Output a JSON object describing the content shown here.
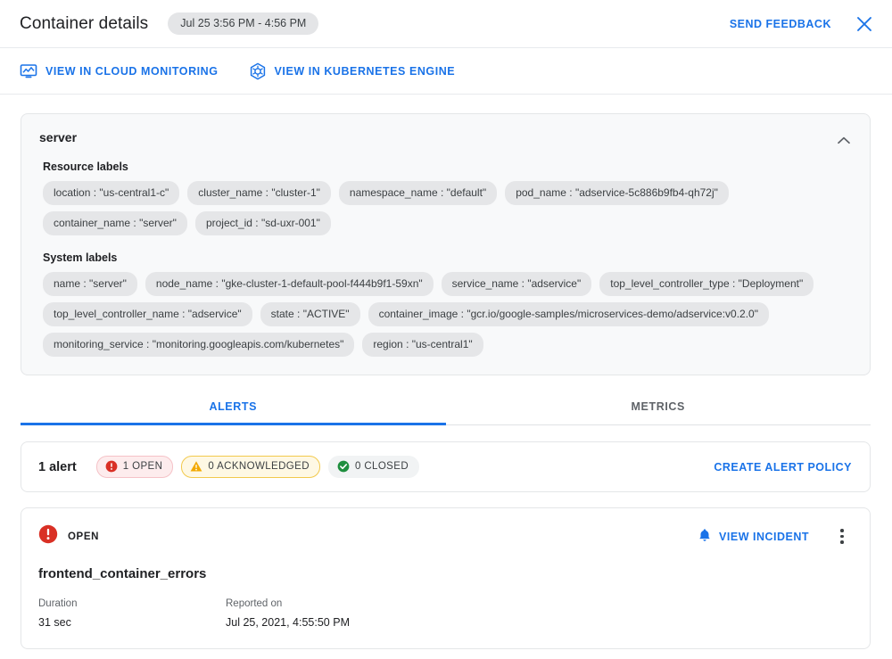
{
  "header": {
    "title": "Container details",
    "time_range": "Jul 25 3:56 PM - 4:56 PM",
    "send_feedback": "SEND FEEDBACK",
    "close_icon": "close-icon"
  },
  "actionbar": {
    "links": [
      {
        "label": "VIEW IN CLOUD MONITORING",
        "icon": "cloud-monitoring-icon"
      },
      {
        "label": "VIEW IN KUBERNETES ENGINE",
        "icon": "kubernetes-engine-icon"
      }
    ]
  },
  "details": {
    "title": "server",
    "collapse_icon": "chevron-up-icon",
    "resource_labels_title": "Resource labels",
    "resource_labels": [
      {
        "key": "location",
        "value": "\"us-central1-c\""
      },
      {
        "key": "cluster_name",
        "value": "\"cluster-1\""
      },
      {
        "key": "namespace_name",
        "value": "\"default\""
      },
      {
        "key": "pod_name",
        "value": "\"adservice-5c886b9fb4-qh72j\""
      },
      {
        "key": "container_name",
        "value": "\"server\""
      },
      {
        "key": "project_id",
        "value": "\"sd-uxr-001\""
      }
    ],
    "system_labels_title": "System labels",
    "system_labels": [
      {
        "key": "name",
        "value": "\"server\""
      },
      {
        "key": "node_name",
        "value": "\"gke-cluster-1-default-pool-f444b9f1-59xn\""
      },
      {
        "key": "service_name",
        "value": "\"adservice\""
      },
      {
        "key": "top_level_controller_type",
        "value": "\"Deployment\""
      },
      {
        "key": "top_level_controller_name",
        "value": "\"adservice\""
      },
      {
        "key": "state",
        "value": "\"ACTIVE\""
      },
      {
        "key": "container_image",
        "value": "\"gcr.io/google-samples/microservices-demo/adservice:v0.2.0\""
      },
      {
        "key": "monitoring_service",
        "value": "\"monitoring.googleapis.com/kubernetes\""
      },
      {
        "key": "region",
        "value": "\"us-central1\""
      }
    ]
  },
  "tabs": [
    {
      "label": "ALERTS",
      "active": true
    },
    {
      "label": "METRICS",
      "active": false
    }
  ],
  "alerts_summary": {
    "count_label": "1 alert",
    "chips": [
      {
        "label": "1 OPEN",
        "state": "open",
        "icon": "error-circle-icon"
      },
      {
        "label": "0 ACKNOWLEDGED",
        "state": "ack",
        "icon": "warning-triangle-icon"
      },
      {
        "label": "0 CLOSED",
        "state": "closed",
        "icon": "check-circle-icon"
      }
    ],
    "create_policy_label": "CREATE ALERT POLICY"
  },
  "incident": {
    "status": "OPEN",
    "status_icon": "error-circle-icon",
    "view_incident_label": "VIEW INCIDENT",
    "view_incident_icon": "bell-icon",
    "kebab_icon": "more-vertical-icon",
    "name": "frontend_container_errors",
    "duration_label": "Duration",
    "duration_value": "31 sec",
    "reported_label": "Reported on",
    "reported_value": "Jul 25, 2021, 4:55:50 PM"
  },
  "colors": {
    "accent_blue": "#1a73e8",
    "open_red": "#d93025",
    "ack_yellow": "#f2c94c",
    "closed_green": "#1e8e3e",
    "chip_gray": "#e5e6e8"
  }
}
